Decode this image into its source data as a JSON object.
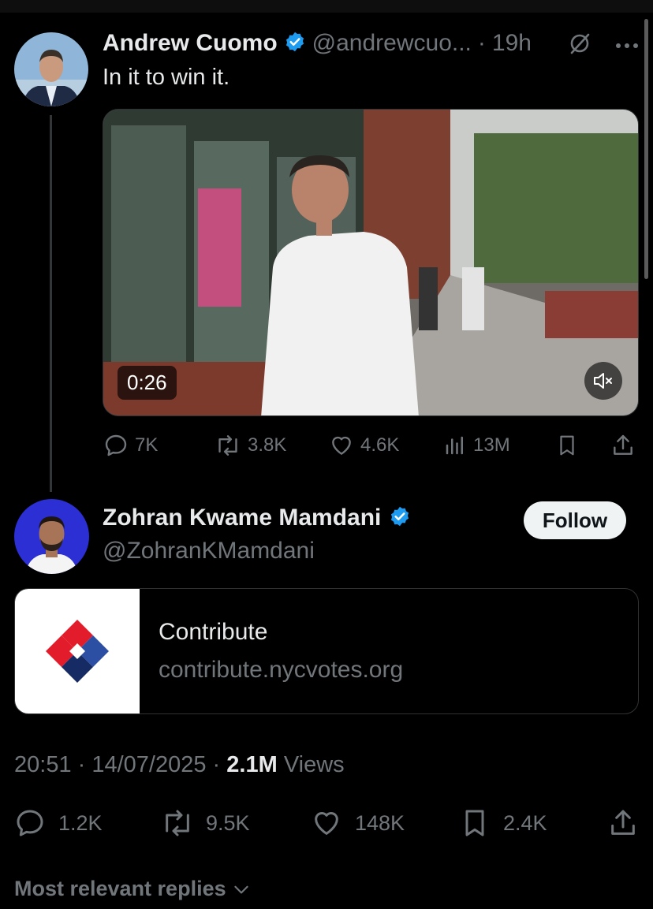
{
  "quoted_tweet": {
    "author_name": "Andrew Cuomo",
    "handle": "@andrewcuo...",
    "separator": "·",
    "time": "19h",
    "text": "In it to win it.",
    "video": {
      "duration": "0:26"
    },
    "stats": {
      "replies": "7K",
      "reposts": "3.8K",
      "likes": "4.6K",
      "views": "13M"
    }
  },
  "main_tweet": {
    "author_name": "Zohran Kwame Mamdani",
    "handle": "@ZohranKMamdani",
    "follow_label": "Follow",
    "card": {
      "title": "Contribute",
      "domain": "contribute.nycvotes.org"
    },
    "timestamp": "20:51 · 14/07/2025 ·",
    "views_count": "2.1M",
    "views_label": "Views",
    "stats": {
      "replies": "1.2K",
      "reposts": "9.5K",
      "likes": "148K",
      "bookmarks": "2.4K"
    }
  },
  "replies_sort_label": "Most relevant replies",
  "colors": {
    "verified": "#1d9bf0",
    "muted": "#71767b",
    "text": "#e7e9ea",
    "background": "#000000"
  }
}
